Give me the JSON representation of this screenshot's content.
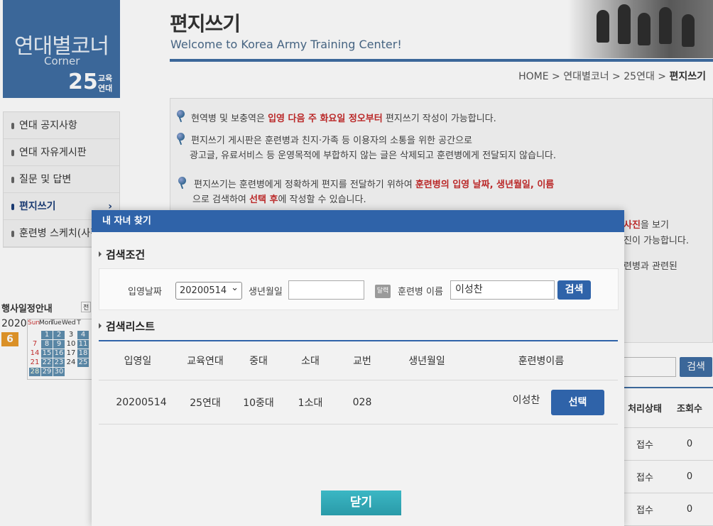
{
  "sidebar": {
    "corner_title": "연대별코너",
    "corner_sub": "Corner",
    "unit_number": "25",
    "unit_label_1": "교육",
    "unit_label_2": "연대",
    "menu": [
      {
        "label": "연대 공지사항"
      },
      {
        "label": "연대 자유게시판"
      },
      {
        "label": "질문 및 답변"
      },
      {
        "label": "편지쓰기",
        "arrow": "›"
      },
      {
        "label": "훈련병 스케치(사진)"
      }
    ],
    "event_title": "행사일정안내",
    "event_all": "전",
    "cal_year": "2020",
    "cal_month": "6",
    "cal_days": [
      "Sun",
      "Mon",
      "Tue",
      "Wed",
      "T"
    ],
    "cal_rows": [
      [
        "",
        "1",
        "2",
        "3",
        "4"
      ],
      [
        "7",
        "8",
        "9",
        "10",
        "11"
      ],
      [
        "14",
        "15",
        "16",
        "17",
        "18"
      ],
      [
        "21",
        "22",
        "23",
        "24",
        "25"
      ],
      [
        "28",
        "29",
        "30",
        "",
        ""
      ]
    ]
  },
  "header": {
    "title": "편지쓰기",
    "subtitle": "Welcome to Korea Army Training Center!",
    "breadcrumb": [
      "HOME",
      "연대별코너",
      "25연대",
      "편지쓰기"
    ]
  },
  "notice": {
    "line1_a": "현역병 및 보충역은 ",
    "line1_red": "입영 다음 주 화요일 정오부터",
    "line1_b": " 편지쓰기 작성이 가능합니다.",
    "line2": "편지쓰기 게시판은 훈련병과 친지·가족 등 이용자의 소통을 위한 공간으로",
    "line3": "광고글, 유료서비스 등 운영목적에 부합하지 않는 글은 삭제되고 훈련병에게 전달되지 않습니다.",
    "line4_a": "편지쓰기는 훈련병에게 정확하게 편지를 전달하기 위하여 ",
    "line4_red": "훈련병의 입영 날짜, 생년월일, 이름",
    "line5_a": "으로 검색하여  ",
    "line5_red": "선택 후",
    "line5_b": "에 작성할 수 있습니다.",
    "peek1_red": "사진",
    "peek1_b": "을 보기",
    "peek2": "진이 가능합니다.",
    "peek3": "련병과 관련된"
  },
  "bg_table": {
    "search_label": "검색",
    "headers": [
      "처리상태",
      "조회수"
    ],
    "rows": [
      [
        "접수",
        "0"
      ],
      [
        "접수",
        "0"
      ],
      [
        "접수",
        "0"
      ]
    ]
  },
  "modal": {
    "title": "내 자녀 찾기",
    "cond_title": "검색조건",
    "enlist_label": "입영날짜",
    "enlist_value": "20200514",
    "birth_label": "생년월일",
    "birth_value": "",
    "cal_icon_text": "달력",
    "name_label": "훈련병 이름",
    "name_value": "이성찬",
    "search_label": "검색",
    "list_title": "검색리스트",
    "columns": [
      "입영일",
      "교육연대",
      "중대",
      "소대",
      "교번",
      "생년월일",
      "훈련병이름"
    ],
    "rows": [
      {
        "enlist": "20200514",
        "regiment": "25연대",
        "company": "10중대",
        "platoon": "1소대",
        "number": "028",
        "birth": "",
        "name": "이성찬",
        "select_label": "선택"
      }
    ],
    "close_label": "닫기"
  },
  "colors": {
    "primary_blue": "#2f63a9",
    "red_text": "#c62b2b",
    "close_teal": "#2fa8b6"
  }
}
